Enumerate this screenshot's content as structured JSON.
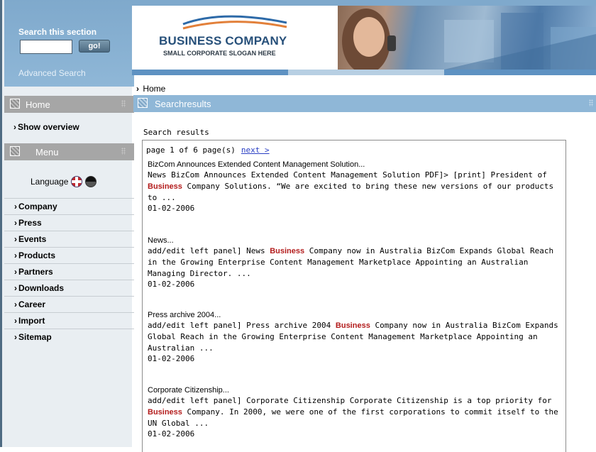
{
  "sidebar": {
    "search": {
      "title": "Search this section",
      "input_value": "",
      "go_label": "go!",
      "advanced_label": "Advanced Search"
    },
    "home_header": "Home",
    "show_overview": "Show overview",
    "menu_header": "Menu",
    "language_label": "Language",
    "items": [
      "Company",
      "Press",
      "Events",
      "Products",
      "Partners",
      "Downloads",
      "Career",
      "Import",
      "Sitemap"
    ]
  },
  "banner": {
    "company_name": "BUSINESS COMPANY",
    "slogan": "SMALL CORPORATE SLOGAN HERE"
  },
  "breadcrumb": "Home",
  "content": {
    "header": "Searchresults",
    "results_label": "Search results",
    "pager": {
      "text": "page 1 of 6 page(s)",
      "next": "next >"
    },
    "results": [
      {
        "title": "BizCom Announces Extended Content Management Solution...",
        "snippet_before": "News BizCom Announces Extended Content Management Solution PDF]> [print] President of ",
        "highlight": "Business",
        "snippet_after": " Company Solutions. “We are excited to bring these new versions of our products to ...",
        "date": "01-02-2006"
      },
      {
        "title": "News...",
        "snippet_before": "add/edit left panel] News ",
        "highlight": "Business",
        "snippet_after": " Company now in Australia BizCom Expands Global Reach in the Growing Enterprise Content Management Marketplace Appointing an Australian Managing Director. ...",
        "date": "01-02-2006"
      },
      {
        "title": "Press archive 2004...",
        "snippet_before": "add/edit left panel] Press archive 2004 ",
        "highlight": "Business",
        "snippet_after": " Company now in Australia BizCom Expands Global Reach in the Growing Enterprise Content Management Marketplace Appointing an Australian ...",
        "date": "01-02-2006"
      },
      {
        "title": "Corporate Citizenship...",
        "snippet_before": "add/edit left panel] Corporate Citizenship Corporate Citizenship is a top priority for ",
        "highlight": "Business",
        "snippet_after": " Company. In 2000, we were one of the first corporations to commit itself to the UN Global ...",
        "date": "01-02-2006"
      }
    ]
  },
  "colors": {
    "accent_blue": "#8fb7d7",
    "highlight_red": "#b31c1c",
    "link_blue": "#2a3fc4"
  }
}
